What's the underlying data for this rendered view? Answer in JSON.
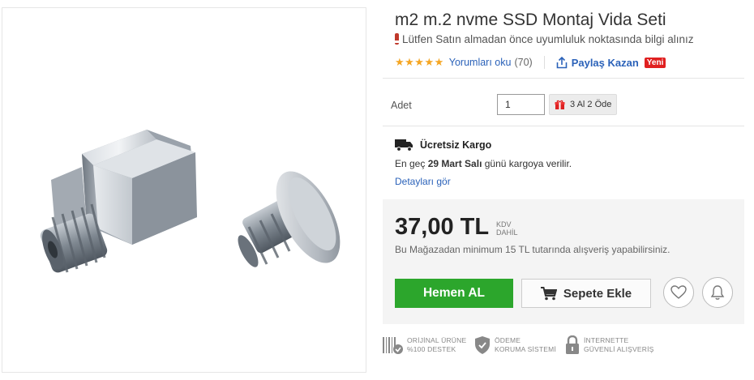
{
  "product": {
    "title": "m2 m.2 nvme SSD Montaj Vida Seti",
    "warning": "Lütfen Satın almadan önce uyumluluk noktasında bilgi alınız",
    "stars": "★★★★★",
    "rating_fraction": 1.0,
    "reviews_link": "Yorumları oku",
    "reviews_count": "(70)",
    "share_label": "Paylaş Kazan",
    "new_badge": "Yeni"
  },
  "quantity": {
    "label": "Adet",
    "value": "1",
    "promo": "3 Al 2 Öde"
  },
  "shipping": {
    "title": "Ücretsiz Kargo",
    "text_prefix": "En geç",
    "date": "29 Mart Salı",
    "text_suffix": "günü kargoya verilir.",
    "details_link": "Detayları gör"
  },
  "price": {
    "amount": "37,00 TL",
    "kdv_line1": "KDV",
    "kdv_line2": "DAHİL",
    "min_note": "Bu Mağazadan minimum 15 TL tutarında alışveriş yapabilirsiniz."
  },
  "actions": {
    "buy_now": "Hemen AL",
    "add_to_cart": "Sepete Ekle"
  },
  "trust": {
    "original_line1": "ORİJİNAL ÜRÜNE",
    "original_line2": "%100 DESTEK",
    "payment_line1": "ÖDEME",
    "payment_line2": "KORUMA SİSTEMİ",
    "secure_line1": "İNTERNETTE",
    "secure_line2": "GÜVENLİ ALIŞVERİŞ"
  },
  "colors": {
    "link": "#2b62b9",
    "buy_button": "#2ca62c",
    "badge": "#e02020",
    "star": "#f5a623"
  }
}
